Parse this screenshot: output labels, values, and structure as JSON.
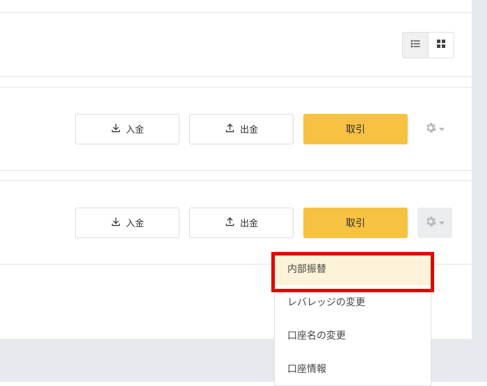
{
  "header": {
    "view_list_label": "list-view",
    "view_grid_label": "grid-view"
  },
  "actions": {
    "deposit": "入金",
    "withdraw": "出金",
    "trade": "取引"
  },
  "menu": {
    "internal_transfer": "内部振替",
    "change_leverage": "レバレッジの変更",
    "change_account_name": "口座名の変更",
    "account_info": "口座情報"
  }
}
